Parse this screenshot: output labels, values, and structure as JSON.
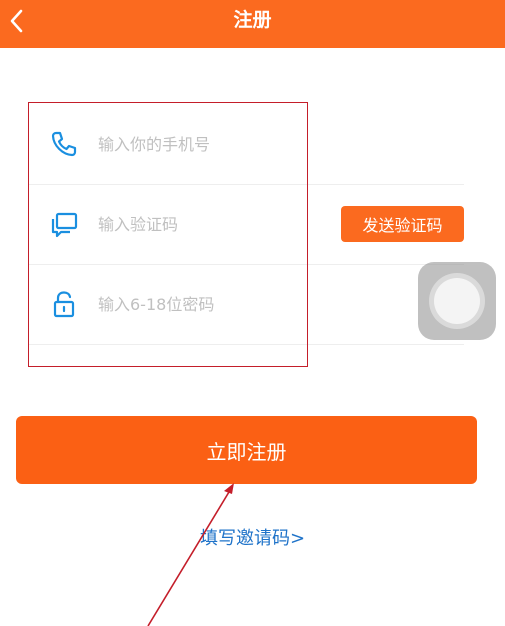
{
  "header": {
    "back_icon": "chevron-left-icon",
    "title": "注册"
  },
  "form": {
    "phone": {
      "icon": "phone-icon",
      "placeholder": "输入你的手机号",
      "value": ""
    },
    "code": {
      "icon": "chat-bubble-icon",
      "placeholder": "输入验证码",
      "value": ""
    },
    "password": {
      "icon": "lock-icon",
      "placeholder": "输入6-18位密码",
      "value": ""
    },
    "send_code_label": "发送验证码"
  },
  "register_label": "立即注册",
  "invite_link": "填写邀请码>",
  "colors": {
    "brand": "#fb6a1f",
    "button": "#fb6014",
    "icon": "#1a8fe0",
    "link": "#1f73c9",
    "annotation": "#c41e2a"
  }
}
